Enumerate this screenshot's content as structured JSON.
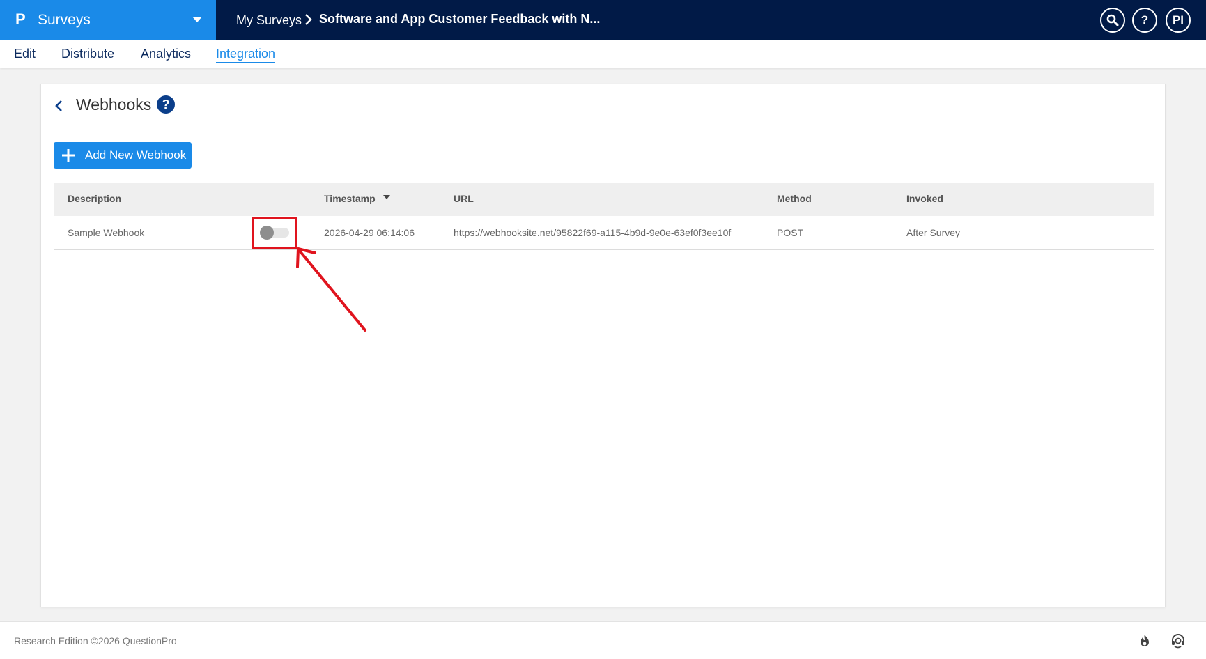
{
  "header": {
    "brand_logo": "P",
    "brand_name": "Surveys",
    "breadcrumb_root": "My Surveys",
    "breadcrumb_current": "Software and App Customer Feedback with N...",
    "help_label": "?",
    "avatar_initials": "PI"
  },
  "nav": {
    "tabs": [
      {
        "label": "Edit"
      },
      {
        "label": "Distribute"
      },
      {
        "label": "Analytics"
      },
      {
        "label": "Integration"
      }
    ],
    "active": "Integration"
  },
  "card": {
    "title": "Webhooks",
    "help_label": "?",
    "add_button_label": "Add New Webhook"
  },
  "table": {
    "columns": [
      "Description",
      "Timestamp",
      "URL",
      "Method",
      "Invoked"
    ],
    "sorted_column": "Timestamp",
    "rows": [
      {
        "description": "Sample Webhook",
        "enabled": false,
        "timestamp": "2026-04-29 06:14:06",
        "url": "https://webhooksite.net/95822f69-a115-4b9d-9e0e-63ef0f3ee10f",
        "method": "POST",
        "invoked": "After Survey"
      }
    ]
  },
  "footer": {
    "text": "Research Edition ©2026 QuestionPro"
  },
  "colors": {
    "topbar": "#011a47",
    "brand": "#1a8ae8",
    "accent": "#1a8ae8",
    "annotation": "#e0141e"
  },
  "icons": [
    "chevron-down-icon",
    "chevron-right-icon",
    "search-icon",
    "help-icon",
    "back-chevron-icon",
    "plus-icon",
    "sort-down-icon",
    "toggle-switch",
    "flame-icon",
    "support-headset-icon"
  ]
}
